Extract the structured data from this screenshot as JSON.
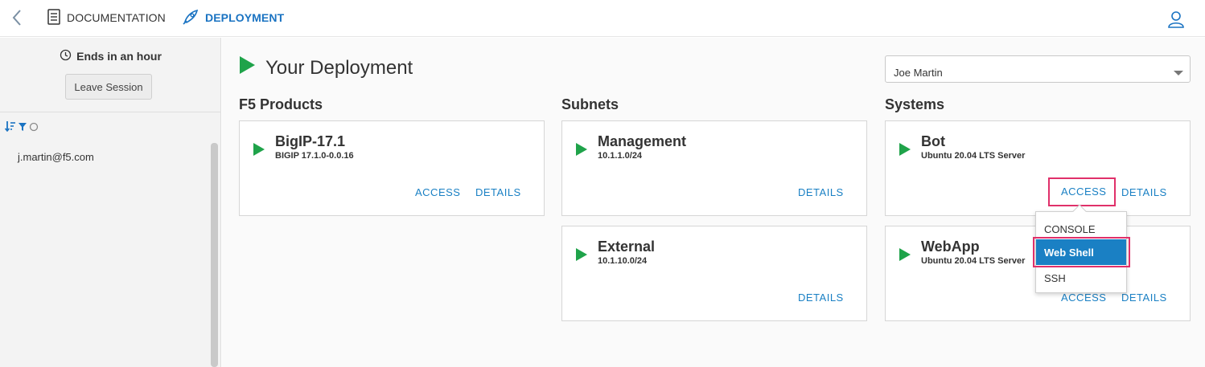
{
  "topbar": {
    "back_icon": "chevron-left-icon",
    "nav_documentation": "DOCUMENTATION",
    "nav_deployment": "DEPLOYMENT",
    "user_icon": "user-icon",
    "accent": "#1a73c2"
  },
  "sidebar": {
    "session_status": "Ends in an hour",
    "leave_button": "Leave Session",
    "user_email": "j.martin@f5.com"
  },
  "main": {
    "page_title": "Your Deployment",
    "user_select_value": "Joe Martin",
    "columns": {
      "products": "F5 Products",
      "subnets": "Subnets",
      "systems": "Systems"
    },
    "cards": {
      "bigip": {
        "name": "BigIP-17.1",
        "sub": "BIGIP 17.1.0-0.0.16",
        "access": "ACCESS",
        "details": "DETAILS"
      },
      "management": {
        "name": "Management",
        "sub": "10.1.1.0/24",
        "details": "DETAILS"
      },
      "external": {
        "name": "External",
        "sub": "10.1.10.0/24",
        "details": "DETAILS"
      },
      "bot": {
        "name": "Bot",
        "sub": "Ubuntu 20.04 LTS Server",
        "access": "ACCESS",
        "details": "DETAILS"
      },
      "webapp": {
        "name": "WebApp",
        "sub": "Ubuntu 20.04 LTS Server",
        "access": "ACCESS",
        "details": "DETAILS"
      }
    },
    "access_menu": {
      "items": [
        "CONSOLE",
        "Web Shell",
        "SSH"
      ],
      "selected": "Web Shell"
    }
  },
  "colors": {
    "play_green": "#1fa34a",
    "link_blue": "#1a80c4",
    "highlight_pink": "#e0306a"
  }
}
